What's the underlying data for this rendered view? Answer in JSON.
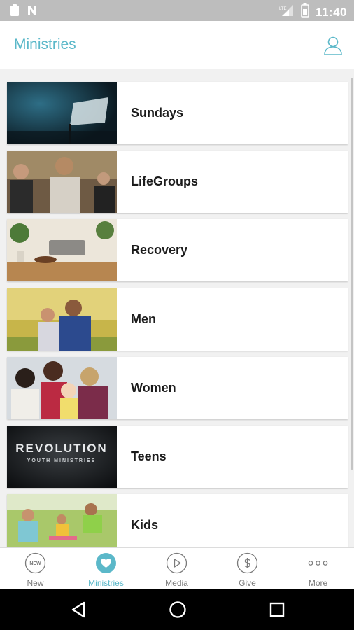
{
  "status_bar": {
    "time": "11:40",
    "network": "LTE"
  },
  "header": {
    "title": "Ministries"
  },
  "ministries": [
    {
      "label": "Sundays"
    },
    {
      "label": "LifeGroups"
    },
    {
      "label": "Recovery"
    },
    {
      "label": "Men"
    },
    {
      "label": "Women"
    },
    {
      "label": "Teens",
      "image_text": [
        "REVOLUTION",
        "YOUTH MINISTRIES"
      ]
    },
    {
      "label": "Kids"
    }
  ],
  "tabs": [
    {
      "label": "New",
      "icon": "new-badge-icon",
      "badge": "NEW"
    },
    {
      "label": "Ministries",
      "icon": "heart-icon",
      "active": true
    },
    {
      "label": "Media",
      "icon": "play-icon"
    },
    {
      "label": "Give",
      "icon": "dollar-icon"
    },
    {
      "label": "More",
      "icon": "more-dots-icon"
    }
  ],
  "colors": {
    "accent": "#5bb8c9",
    "status_bar": "#bdbdbd",
    "tab_inactive": "#7a7a7a"
  }
}
